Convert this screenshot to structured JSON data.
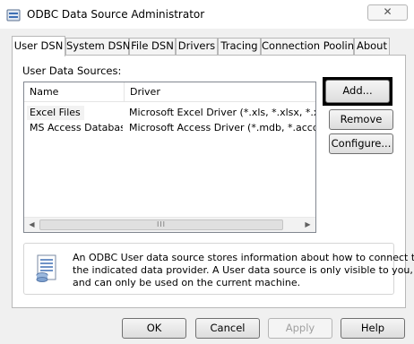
{
  "window": {
    "title": "ODBC Data Source Administrator",
    "close_glyph": "✕"
  },
  "tabs": [
    {
      "label": "User DSN",
      "active": true
    },
    {
      "label": "System DSN",
      "active": false
    },
    {
      "label": "File DSN",
      "active": false
    },
    {
      "label": "Drivers",
      "active": false
    },
    {
      "label": "Tracing",
      "active": false
    },
    {
      "label": "Connection Pooling",
      "active": false
    },
    {
      "label": "About",
      "active": false
    }
  ],
  "panel": {
    "list_label": "User Data Sources:",
    "columns": [
      "Name",
      "Driver"
    ],
    "rows": [
      {
        "name": "Excel Files",
        "driver": "Microsoft Excel Driver (*.xls, *.xlsx, *.xlsm, *.x",
        "selected": true
      },
      {
        "name": "MS Access Database",
        "driver": "Microsoft Access Driver (*.mdb, *.accdb)",
        "selected": false
      }
    ],
    "scroll_left": "◀",
    "scroll_right": "▶",
    "scroll_grip": "III"
  },
  "side_buttons": {
    "add": "Add...",
    "remove": "Remove",
    "configure": "Configure..."
  },
  "info": {
    "lines": [
      "An ODBC User data source stores information about how to connect to",
      "the indicated data provider.   A User data source is only visible to you,",
      "and can only be used on the current machine."
    ],
    "icon": "database-document-icon"
  },
  "footer": {
    "ok": "OK",
    "cancel": "Cancel",
    "apply": "Apply",
    "help": "Help"
  },
  "colors": {
    "panel_bg": "#ffffff",
    "window_bg": "#f0f0f0",
    "focus_border": "#000000"
  }
}
